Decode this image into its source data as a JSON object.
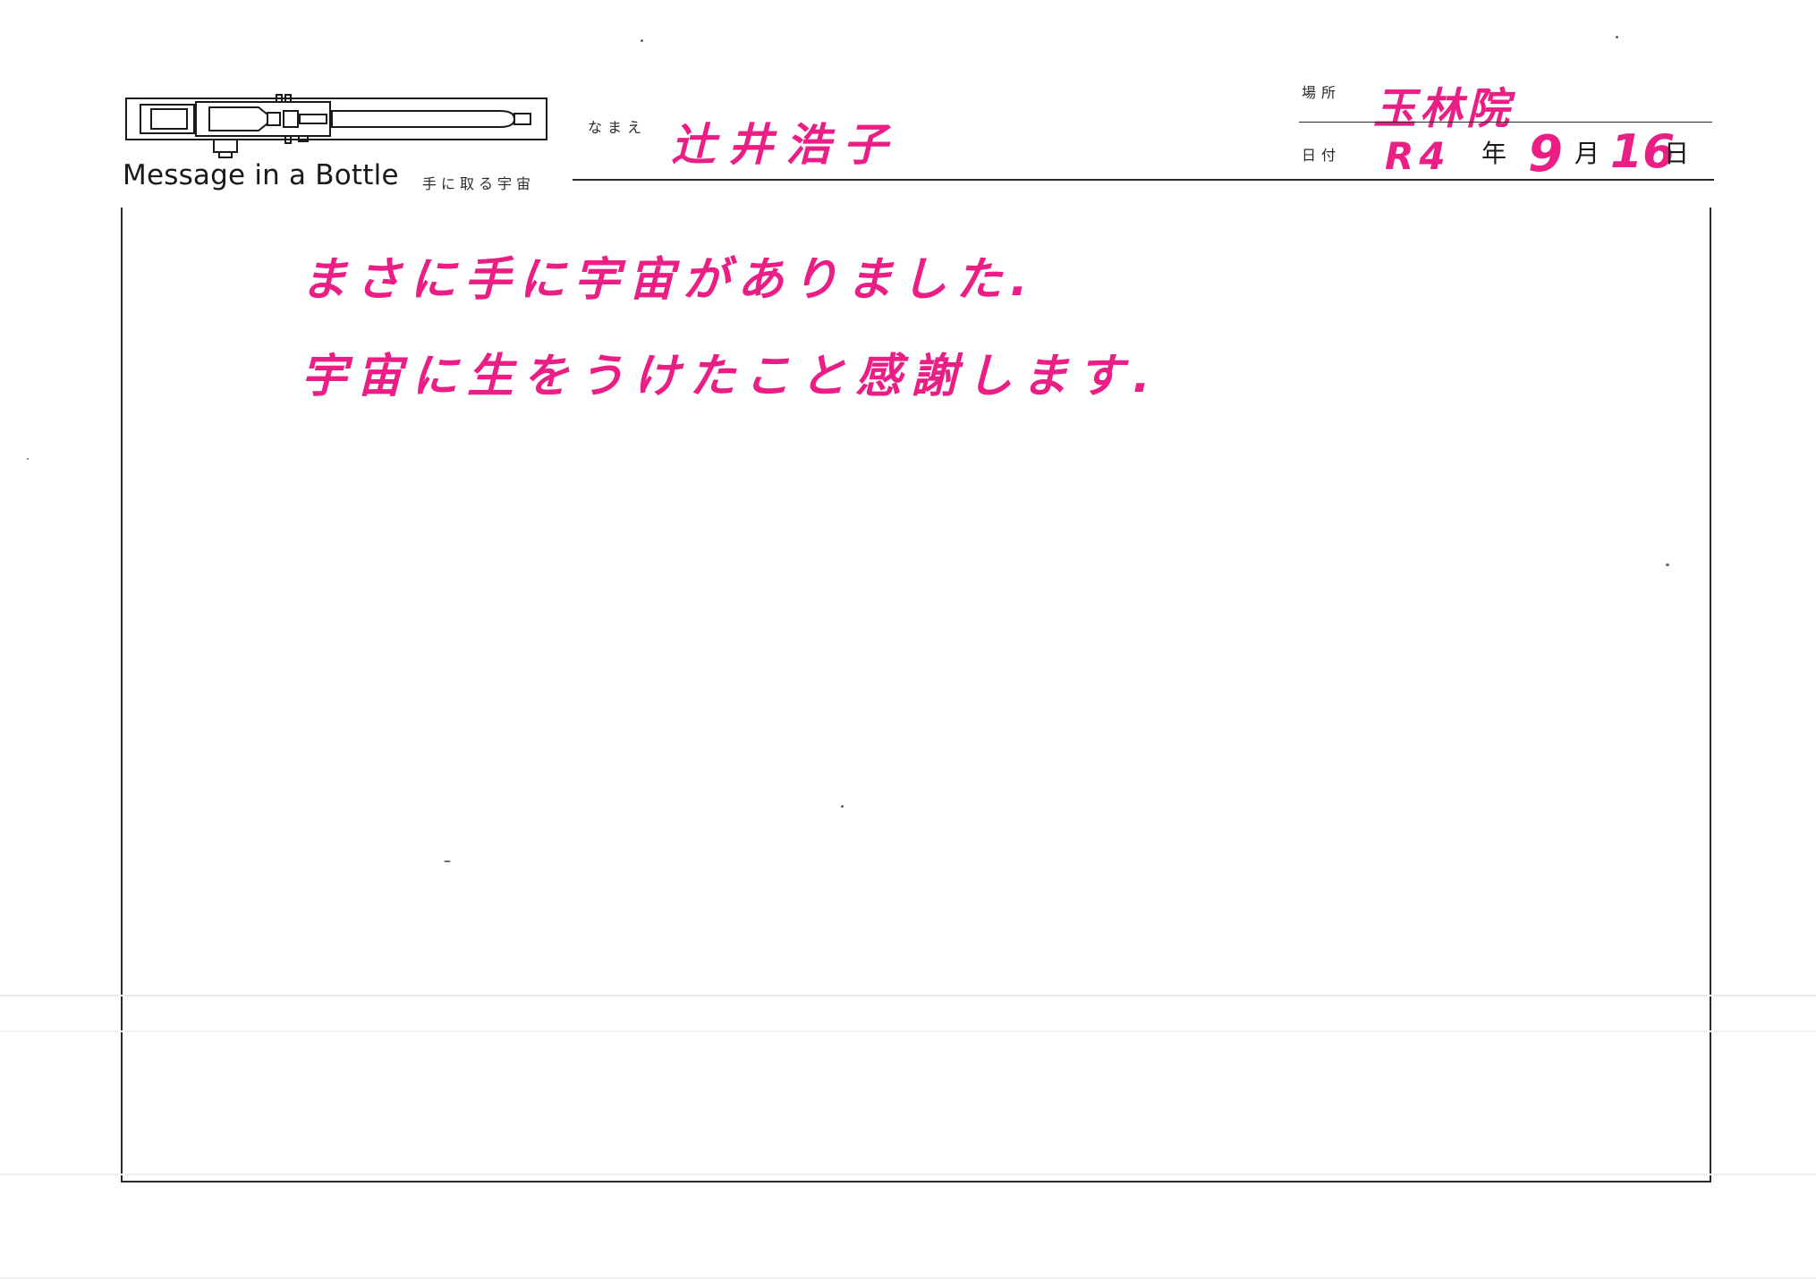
{
  "brand": {
    "title": "Message in a Bottle",
    "subtitle": "手に取る宇宙"
  },
  "form": {
    "name_label": "なまえ",
    "name_value": "辻井浩子",
    "place_label": "場所",
    "place_value": "玉林院",
    "date_label": "日付",
    "era_value": "R4",
    "year_unit": "年",
    "month_value": "9",
    "month_unit": "月",
    "day_value": "16",
    "day_unit": "日"
  },
  "message": {
    "lines": [
      "まさに手に宇宙がありました.",
      "宇宙に生をうけたこと感謝します."
    ]
  },
  "colors": {
    "ink": "#ea1e84",
    "print": "#1a1a1a"
  }
}
